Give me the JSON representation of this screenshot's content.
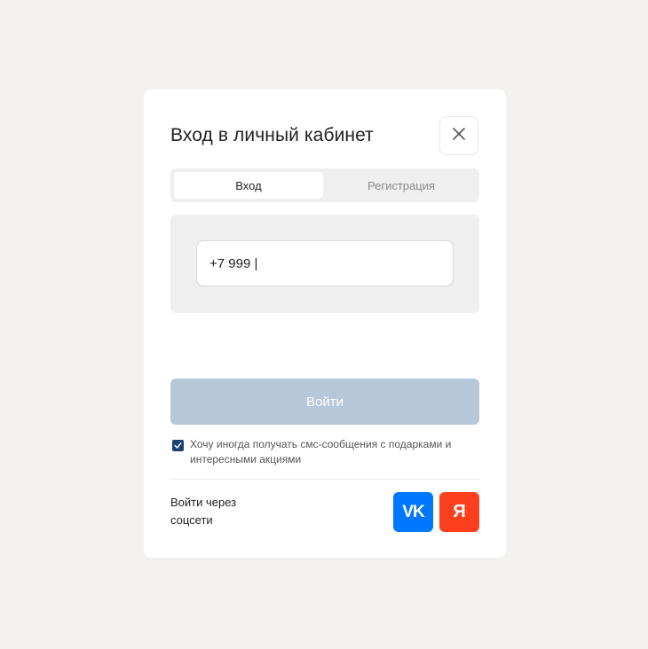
{
  "modal": {
    "title": "Вход в личный кабинет",
    "close_icon": "close-icon"
  },
  "tabs": [
    {
      "label": "Вход",
      "active": true
    },
    {
      "label": "Регистрация",
      "active": false
    }
  ],
  "phone": {
    "value": "+7 999 |"
  },
  "login_button": {
    "label": "Войти"
  },
  "consent": {
    "checked": true,
    "text": "Хочу иногда получать смс-сообщения с подарками и интересными акциями"
  },
  "social": {
    "label": "Войти через соцсети",
    "vk_label": "VK",
    "yandex_label": "Я"
  },
  "colors": {
    "background": "#f3f2f0",
    "login_button": "#b7c7da",
    "checkbox": "#1a4372",
    "vk": "#0077ff",
    "yandex": "#fc3f1d"
  }
}
